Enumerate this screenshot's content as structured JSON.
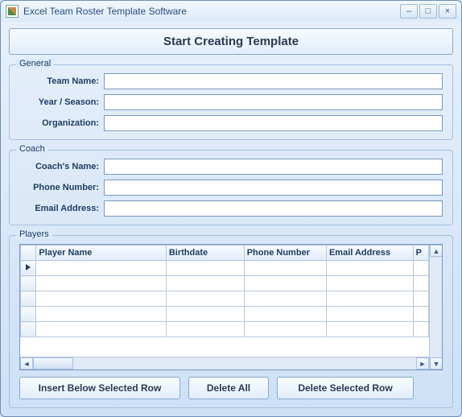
{
  "window": {
    "title": "Excel Team Roster Template Software"
  },
  "main_button": "Start Creating Template",
  "general": {
    "legend": "General",
    "team_name_label": "Team Name:",
    "team_name_value": "",
    "year_season_label": "Year / Season:",
    "year_season_value": "",
    "organization_label": "Organization:",
    "organization_value": ""
  },
  "coach": {
    "legend": "Coach",
    "name_label": "Coach's Name:",
    "name_value": "",
    "phone_label": "Phone Number:",
    "phone_value": "",
    "email_label": "Email Address:",
    "email_value": ""
  },
  "players": {
    "legend": "Players",
    "columns": [
      "Player Name",
      "Birthdate",
      "Phone Number",
      "Email Address",
      "P"
    ]
  },
  "buttons": {
    "insert": "Insert Below Selected Row",
    "delete_all": "Delete All",
    "delete_selected": "Delete Selected Row"
  }
}
